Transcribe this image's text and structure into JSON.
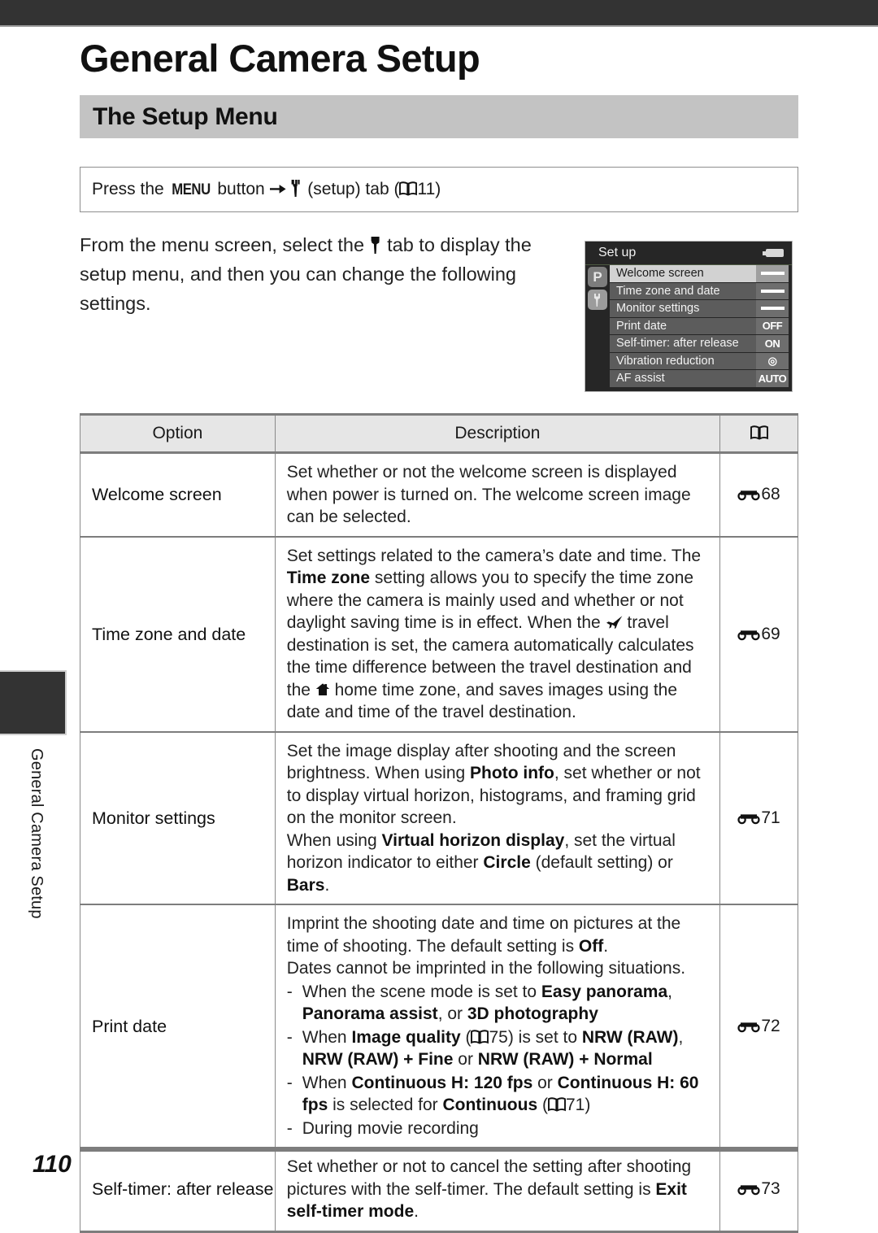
{
  "page": {
    "title": "General Camera Setup",
    "section_heading": "The Setup Menu",
    "folio": "110",
    "side_tab_label": "General Camera Setup"
  },
  "instruction": {
    "prefix": "Press the ",
    "menu_button": "MENU",
    "middle": " button ",
    "arrow_icon": "right-arrow-icon",
    "wrench_icon": "wrench-icon",
    "suffix": " (setup) tab (",
    "book_icon": "book-icon",
    "page_ref": "11",
    "close": ")"
  },
  "intro": {
    "part1": "From the menu screen, select the ",
    "wrench_icon": "wrench-icon",
    "part2": " tab to display the setup menu, and then you can change the following settings."
  },
  "lcd": {
    "title": "Set up",
    "battery_icon": "battery-icon",
    "tabs": [
      {
        "label": "P",
        "name": "shooting-mode-tab",
        "active": false
      },
      {
        "label": "Y",
        "name": "setup-tab",
        "active": true
      }
    ],
    "rows": [
      {
        "label": "Welcome screen",
        "value": "--",
        "value_kind": "dashes",
        "selected": true
      },
      {
        "label": "Time zone and date",
        "value": "--",
        "value_kind": "dashes",
        "selected": false
      },
      {
        "label": "Monitor settings",
        "value": "--",
        "value_kind": "dashes",
        "selected": false
      },
      {
        "label": "Print date",
        "value": "OFF",
        "value_kind": "text",
        "selected": false
      },
      {
        "label": "Self-timer: after release",
        "value": "ON",
        "value_kind": "text",
        "selected": false
      },
      {
        "label": "Vibration reduction",
        "value": "VR",
        "value_kind": "glyph",
        "selected": false
      },
      {
        "label": "AF assist",
        "value": "AUTO",
        "value_kind": "text",
        "selected": false
      }
    ]
  },
  "table": {
    "headers": {
      "option": "Option",
      "description": "Description",
      "reference": "book-icon"
    },
    "rows": [
      {
        "option": "Welcome screen",
        "reference": "68",
        "description_plain": "Set whether or not the welcome screen is displayed when power is turned on. The welcome screen image can be selected."
      },
      {
        "option": "Time zone and date",
        "reference": "69",
        "description_plain": "Set settings related to the camera's date and time. The Time zone setting allows you to specify the time zone where the camera is mainly used and whether or not daylight saving time is in effect. When the ✈ travel destination is set, the camera automatically calculates the time difference between the travel destination and the ⌂ home time zone, and saves images using the date and time of the travel destination.",
        "bold_terms": [
          "Time zone"
        ]
      },
      {
        "option": "Monitor settings",
        "reference": "71",
        "description_plain": "Set the image display after shooting and the screen brightness. When using Photo info, set whether or not to display virtual horizon, histograms, and framing grid on the monitor screen. When using Virtual horizon display, set the virtual horizon indicator to either Circle (default setting) or Bars.",
        "bold_terms": [
          "Photo info",
          "Virtual horizon display",
          "Circle",
          "Bars"
        ]
      },
      {
        "option": "Print date",
        "reference": "72",
        "description_plain": "Imprint the shooting date and time on pictures at the time of shooting. The default setting is Off. Dates cannot be imprinted in the following situations.",
        "bold_terms": [
          "Off"
        ],
        "bullets": [
          "When the scene mode is set to Easy panorama, Panorama assist, or 3D photography",
          "When Image quality (75) is set to NRW (RAW), NRW (RAW) + Fine or NRW (RAW) + Normal",
          "When Continuous H: 120 fps or Continuous H: 60 fps is selected for Continuous (71)",
          "During movie recording"
        ]
      },
      {
        "option": "Self-timer: after release",
        "reference": "73",
        "description_plain": "Set whether or not to cancel the setting after shooting pictures with the self-timer. The default setting is Exit self-timer mode.",
        "bold_terms": [
          "Exit self-timer mode"
        ]
      }
    ]
  },
  "text_fragments": {
    "r1_d1": "Set whether or not the welcome screen is displayed when power is turned on. The welcome screen image can be selected.",
    "r2_a": "Set settings related to the camera’s date and time. The ",
    "r2_b": "Time zone",
    "r2_c": " setting allows you to specify the time zone where the camera is mainly used and whether or not daylight saving time is in effect. When the ",
    "r2_d": " travel destination is set, the camera automatically calculates the time difference between the travel destination and the ",
    "r2_e": " home time zone, and saves images using the date and time of the travel destination.",
    "r3_a": "Set the image display after shooting and the screen brightness. When using ",
    "r3_b": "Photo info",
    "r3_c": ", set whether or not to display virtual horizon, histograms, and framing grid on the monitor screen.",
    "r3_d": "When using ",
    "r3_e": "Virtual horizon display",
    "r3_f": ", set the virtual horizon indicator to either ",
    "r3_g": "Circle",
    "r3_h": " (default setting) or ",
    "r3_i": "Bars",
    "r3_j": ".",
    "r4_a": "Imprint the shooting date and time on pictures at the time of shooting. The default setting is ",
    "r4_b": "Off",
    "r4_c": ".",
    "r4_d": "Dates cannot be imprinted in the following situations.",
    "r4_b1_a": "When the scene mode is set to ",
    "r4_b1_b": "Easy panorama",
    "r4_b1_c": ", ",
    "r4_b1_d": "Panorama assist",
    "r4_b1_e": ", or ",
    "r4_b1_f": "3D photography",
    "r4_b2_a": "When ",
    "r4_b2_b": "Image quality",
    "r4_b2_c": " (",
    "r4_b2_d": "75",
    "r4_b2_e": ") is set to ",
    "r4_b2_f": "NRW (RAW)",
    "r4_b2_g": ", ",
    "r4_b2_h": "NRW (RAW) + Fine",
    "r4_b2_i": " or ",
    "r4_b2_j": "NRW (RAW) + Normal",
    "r4_b3_a": "When ",
    "r4_b3_b": "Continuous H: 120 fps",
    "r4_b3_c": " or ",
    "r4_b3_d": "Continuous H: 60 fps",
    "r4_b3_e": " is selected for ",
    "r4_b3_f": "Continuous",
    "r4_b3_g": " (",
    "r4_b3_h": "71",
    "r4_b3_i": ")",
    "r4_b4": "During movie recording",
    "r5_a": "Set whether or not to cancel the setting after shooting pictures with the self-timer. The default setting is ",
    "r5_b": "Exit self-timer mode",
    "r5_c": ".",
    "dash": "-"
  },
  "colors": {
    "dark_bar": "#333333",
    "section_band": "#c3c3c3",
    "table_header": "#e6e6e6",
    "rule": "#7d7d7d",
    "lcd_bg": "#262626",
    "lcd_selected_row": "#d2d2d2",
    "lcd_row": "#5c5c5c"
  }
}
